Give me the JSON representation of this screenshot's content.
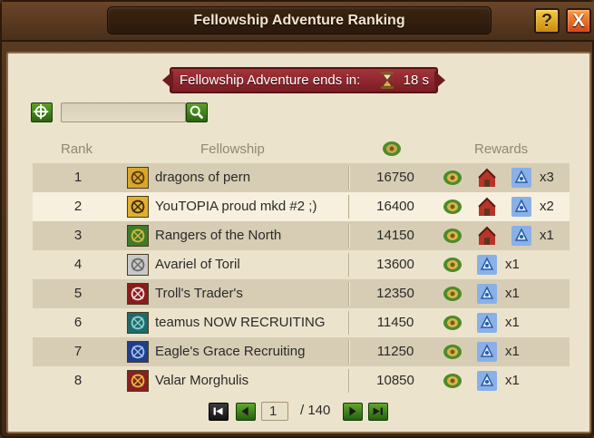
{
  "window": {
    "title": "Fellowship Adventure Ranking",
    "help_label": "?",
    "close_label": "X"
  },
  "timer": {
    "label": "Fellowship Adventure ends in:",
    "value": "18 s"
  },
  "search": {
    "value": "",
    "placeholder": ""
  },
  "table": {
    "headers": {
      "rank": "Rank",
      "fellowship": "Fellowship",
      "rewards": "Rewards"
    },
    "rows": [
      {
        "rank": "1",
        "name": "dragons of pern",
        "score": "16750",
        "crest": "gold-dragon-crest",
        "rewards": [
          "trophy-icon",
          "house-icon",
          "rune-shard-icon"
        ],
        "mult": "x3"
      },
      {
        "rank": "2",
        "name": "YouTOPIA proud mkd #2 ;)",
        "score": "16400",
        "crest": "gold-lion-crest",
        "rewards": [
          "trophy-icon",
          "house-icon",
          "rune-shard-icon"
        ],
        "mult": "x2"
      },
      {
        "rank": "3",
        "name": "Rangers of the North",
        "score": "14150",
        "crest": "green-gold-crest",
        "rewards": [
          "trophy-icon",
          "house-icon",
          "rune-shard-icon"
        ],
        "mult": "x1"
      },
      {
        "rank": "4",
        "name": "Avariel of Toril",
        "score": "13600",
        "crest": "silver-crest",
        "rewards": [
          "trophy-icon",
          "rune-shard-icon"
        ],
        "mult": "x1"
      },
      {
        "rank": "5",
        "name": "Troll's Trader's",
        "score": "12350",
        "crest": "red-wreath-crest",
        "rewards": [
          "trophy-icon",
          "rune-shard-icon"
        ],
        "mult": "x1"
      },
      {
        "rank": "6",
        "name": "teamus NOW RECRUITING",
        "score": "11450",
        "crest": "teal-swords-crest",
        "rewards": [
          "trophy-icon",
          "rune-shard-icon"
        ],
        "mult": "x1"
      },
      {
        "rank": "7",
        "name": "Eagle's Grace Recruiting",
        "score": "11250",
        "crest": "blue-eagle-crest",
        "rewards": [
          "trophy-icon",
          "rune-shard-icon"
        ],
        "mult": "x1"
      },
      {
        "rank": "8",
        "name": "Valar Morghulis",
        "score": "10850",
        "crest": "red-swords-crest",
        "rewards": [
          "trophy-icon",
          "rune-shard-icon"
        ],
        "mult": "x1"
      }
    ]
  },
  "pager": {
    "current": "1",
    "total": "/ 140"
  },
  "colors": {
    "panel": "#ece3cd",
    "row_alt": "#d7cdb4",
    "timer_banner": "#8c262d",
    "frame": "#4a2f1c",
    "green_button": "#3f8a1c"
  }
}
